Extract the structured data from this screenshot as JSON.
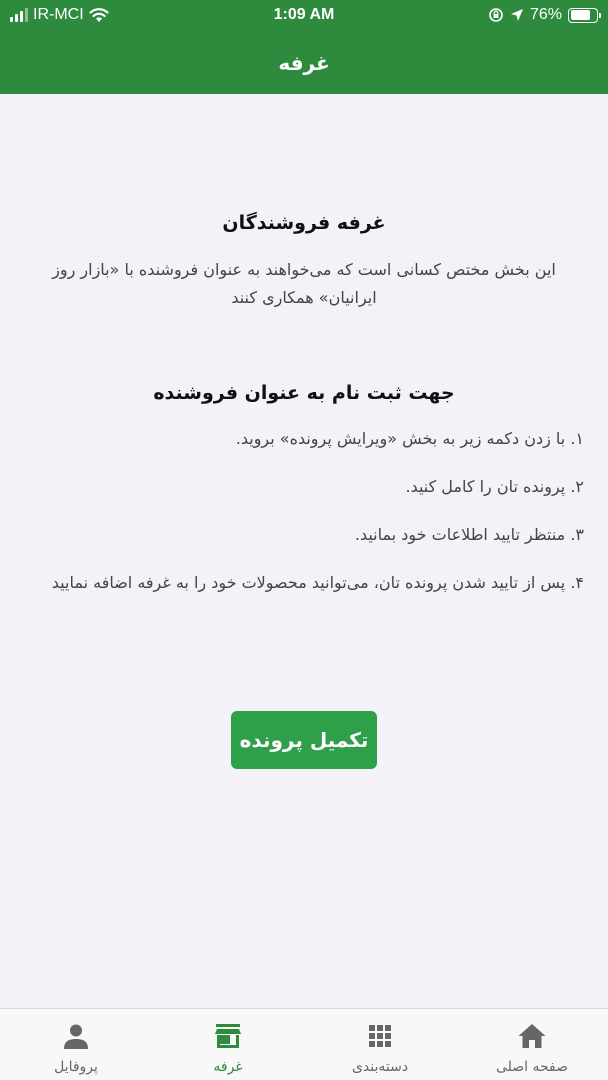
{
  "status_bar": {
    "carrier": "IR-MCI",
    "time": "1:09 AM",
    "battery_percent": "76%",
    "battery_level": 0.76
  },
  "header": {
    "title": "غرفه"
  },
  "content": {
    "heading": "غرفه فروشندگان",
    "intro": "این بخش مختص کسانی است که می‌خواهند به عنوان فروشنده با «بازار روز ایرانیان» همکاری کنند",
    "register_heading": "جهت ثبت نام به عنوان فروشنده",
    "steps": [
      "۱. با زدن دکمه زیر به بخش «ویرایش پرونده» بروید.",
      "۲. پرونده تان را کامل کنید.",
      "۳. منتظر تایید اطلاعات خود بمانید.",
      "۴. پس از تایید شدن پرونده تان، می‌توانید محصولات خود را به غرفه اضافه نمایید"
    ],
    "button_label": "تکمیل پرونده"
  },
  "tabbar": {
    "active_tab": "booth",
    "items": [
      {
        "id": "profile",
        "label": "پروفایل",
        "icon": "person-icon"
      },
      {
        "id": "booth",
        "label": "غرفه",
        "icon": "store-icon"
      },
      {
        "id": "categories",
        "label": "دسته‌بندی",
        "icon": "grid-icon"
      },
      {
        "id": "home",
        "label": "صفحه اصلی",
        "icon": "home-icon"
      }
    ]
  },
  "colors": {
    "primary": "#2e8b3e",
    "button": "#2fa04a",
    "background": "#f2f2f7",
    "tab_inactive": "#666666"
  }
}
